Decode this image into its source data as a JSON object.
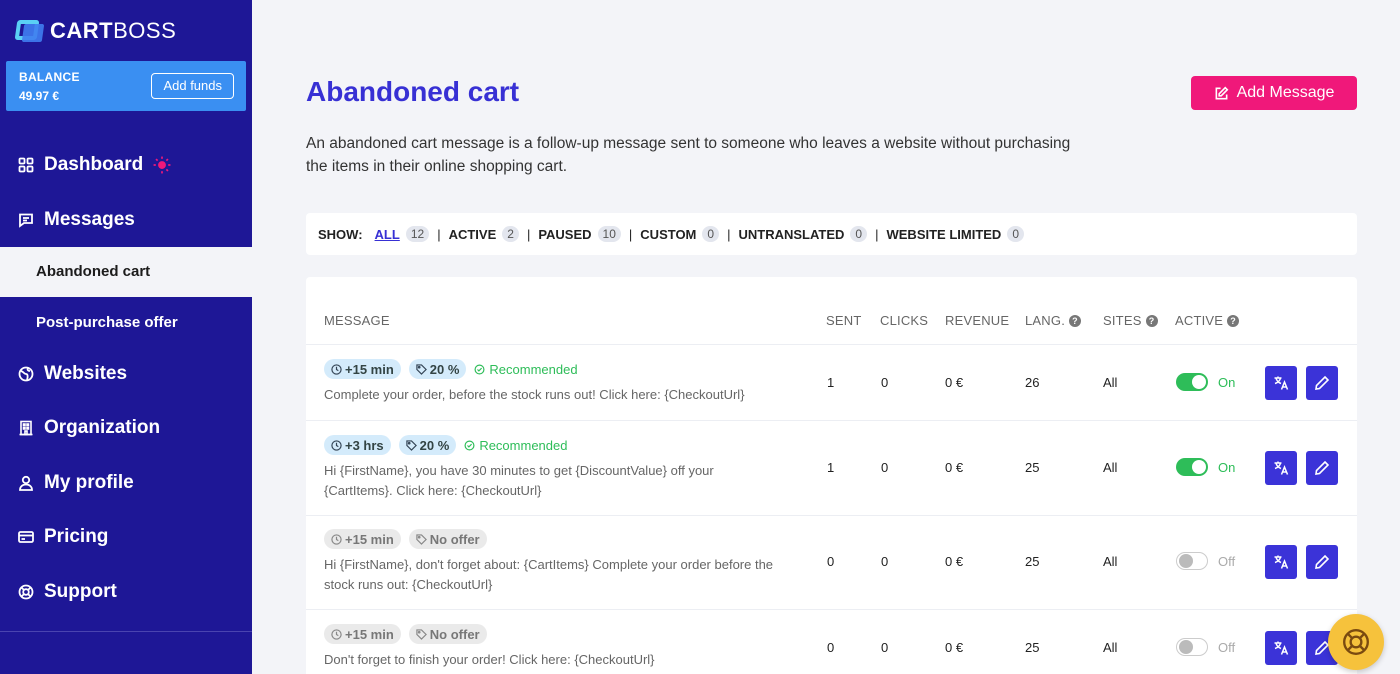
{
  "brand": {
    "name_bold": "CART",
    "name_light": "BOSS"
  },
  "balance": {
    "label": "BALANCE",
    "value": "49.97 €",
    "add_funds": "Add funds"
  },
  "nav": {
    "dashboard": "Dashboard",
    "messages": "Messages",
    "abandoned_cart": "Abandoned cart",
    "post_purchase": "Post-purchase offer",
    "websites": "Websites",
    "organization": "Organization",
    "my_profile": "My profile",
    "pricing": "Pricing",
    "support": "Support"
  },
  "page": {
    "title": "Abandoned cart",
    "add_message": "Add Message",
    "description": "An abandoned cart message is a follow-up message sent to someone who leaves a website without purchasing the items in their online shopping cart."
  },
  "filters": {
    "show_label": "SHOW:",
    "items": [
      {
        "label": "ALL",
        "count": "12"
      },
      {
        "label": "ACTIVE",
        "count": "2"
      },
      {
        "label": "PAUSED",
        "count": "10"
      },
      {
        "label": "CUSTOM",
        "count": "0"
      },
      {
        "label": "UNTRANSLATED",
        "count": "0"
      },
      {
        "label": "WEBSITE LIMITED",
        "count": "0"
      }
    ]
  },
  "table": {
    "headers": {
      "message": "MESSAGE",
      "sent": "SENT",
      "clicks": "CLICKS",
      "revenue": "REVENUE",
      "lang": "LANG.",
      "sites": "SITES",
      "active": "ACTIVE"
    },
    "rows": [
      {
        "delay": "+15 min",
        "offer": "20 %",
        "recommended": "Recommended",
        "text": "Complete your order, before the stock runs out! Click here: {CheckoutUrl}",
        "sent": "1",
        "clicks": "0",
        "revenue": "0 €",
        "lang": "26",
        "sites": "All",
        "status": "On"
      },
      {
        "delay": "+3 hrs",
        "offer": "20 %",
        "recommended": "Recommended",
        "text": "Hi {FirstName}, you have 30 minutes to get {DiscountValue} off your {CartItems}. Click here: {CheckoutUrl}",
        "sent": "1",
        "clicks": "0",
        "revenue": "0 €",
        "lang": "25",
        "sites": "All",
        "status": "On"
      },
      {
        "delay": "+15 min",
        "offer": "No offer",
        "recommended": "",
        "text": "Hi {FirstName}, don't forget about: {CartItems} Complete your order before the stock runs out: {CheckoutUrl}",
        "sent": "0",
        "clicks": "0",
        "revenue": "0 €",
        "lang": "25",
        "sites": "All",
        "status": "Off"
      },
      {
        "delay": "+15 min",
        "offer": "No offer",
        "recommended": "",
        "text": "Don't forget to finish your order! Click here: {CheckoutUrl}",
        "sent": "0",
        "clicks": "0",
        "revenue": "0 €",
        "lang": "25",
        "sites": "All",
        "status": "Off"
      }
    ]
  }
}
